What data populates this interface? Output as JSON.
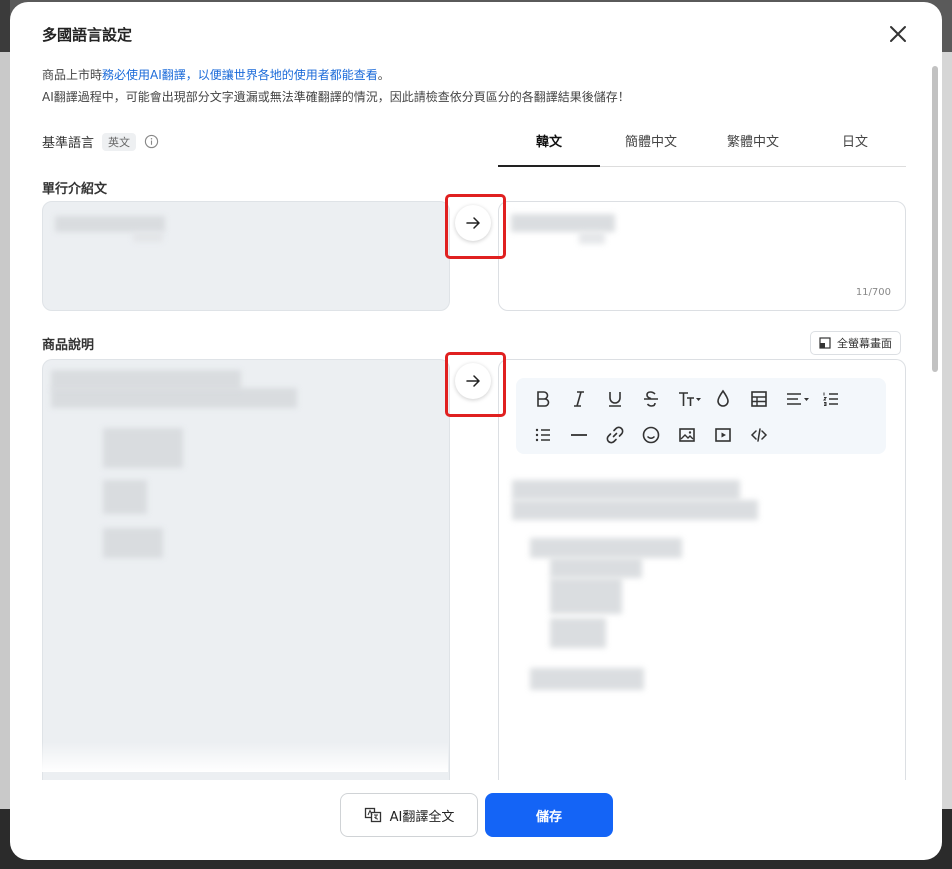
{
  "modal": {
    "title": "多國語言設定",
    "notice_line1_prefix": "商品上市時",
    "notice_line1_highlight": "務必使用AI翻譯，以便讓世界各地的使用者都能查看",
    "notice_line1_suffix": "。",
    "notice_line2": "AI翻譯過程中，可能會出現部分文字遺漏或無法準確翻譯的情況，因此請檢查依分頁區分的各翻譯結果後儲存！"
  },
  "base_language": {
    "label": "基準語言",
    "value": "英文"
  },
  "tabs": [
    {
      "label": "韓文",
      "active": true
    },
    {
      "label": "簡體中文",
      "active": false
    },
    {
      "label": "繁體中文",
      "active": false
    },
    {
      "label": "日文",
      "active": false
    }
  ],
  "sections": {
    "intro_label": "單行介紹文",
    "intro_counter": "11/700",
    "description_label": "商品說明",
    "fullscreen_label": "全螢幕畫面"
  },
  "toolbar": {
    "items": [
      "bold",
      "italic",
      "underline",
      "strikethrough",
      "font-size",
      "color",
      "table",
      "align",
      "ordered-list",
      "bullet-list",
      "horizontal-rule",
      "link",
      "emoji",
      "image",
      "video",
      "code"
    ]
  },
  "footer": {
    "ai_translate_label": "AI翻譯全文",
    "save_label": "儲存"
  },
  "colors": {
    "accent": "#1464f6",
    "highlight_text": "#1a6ad9",
    "annotation_red": "#e02020"
  }
}
